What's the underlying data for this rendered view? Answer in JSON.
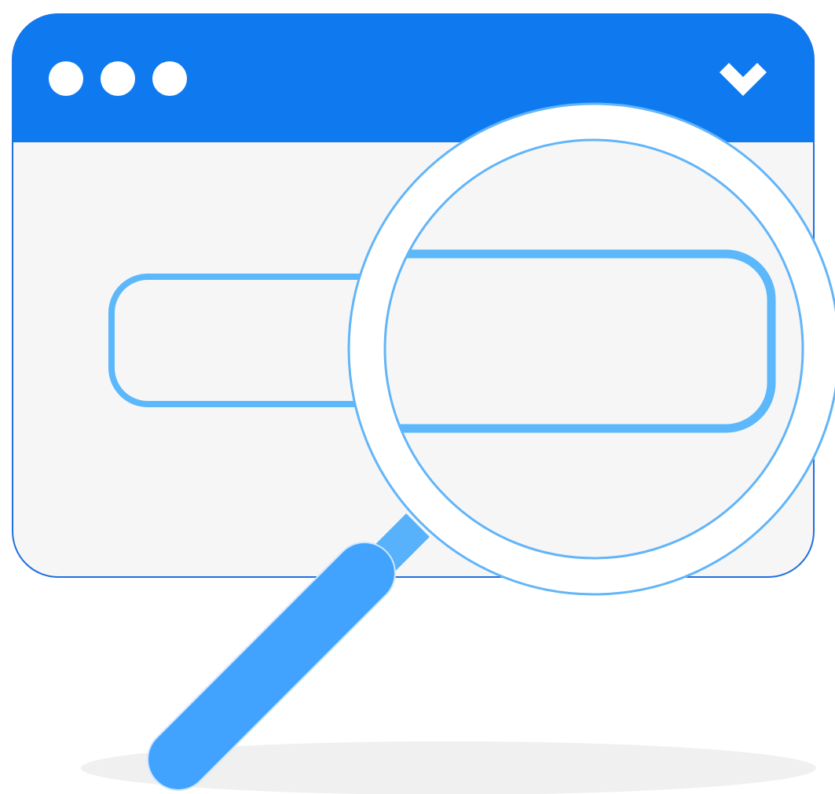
{
  "illustration": {
    "subject": "browser-window-with-magnifying-glass",
    "window": {
      "controls": [
        "dot-1",
        "dot-2",
        "dot-3"
      ],
      "menu_icon": "chevron-down-icon"
    },
    "search_field": {
      "value": "",
      "placeholder": ""
    },
    "magnifier_icon": "magnifying-glass-icon"
  },
  "colors": {
    "title_bar": "#0f7af0",
    "window_border": "#1e6fe0",
    "window_body": "#f6f6f7",
    "field_outline": "#5cb8fb",
    "lens_ring_stroke": "#62b5f8",
    "lens_fill": "#ffffff",
    "handle_neck": "#57b2fb",
    "handle": "#42a3ff",
    "handle_outline": "#cfe7ff",
    "shadow": "#f0f0f0",
    "control_dot": "#ffffff"
  }
}
